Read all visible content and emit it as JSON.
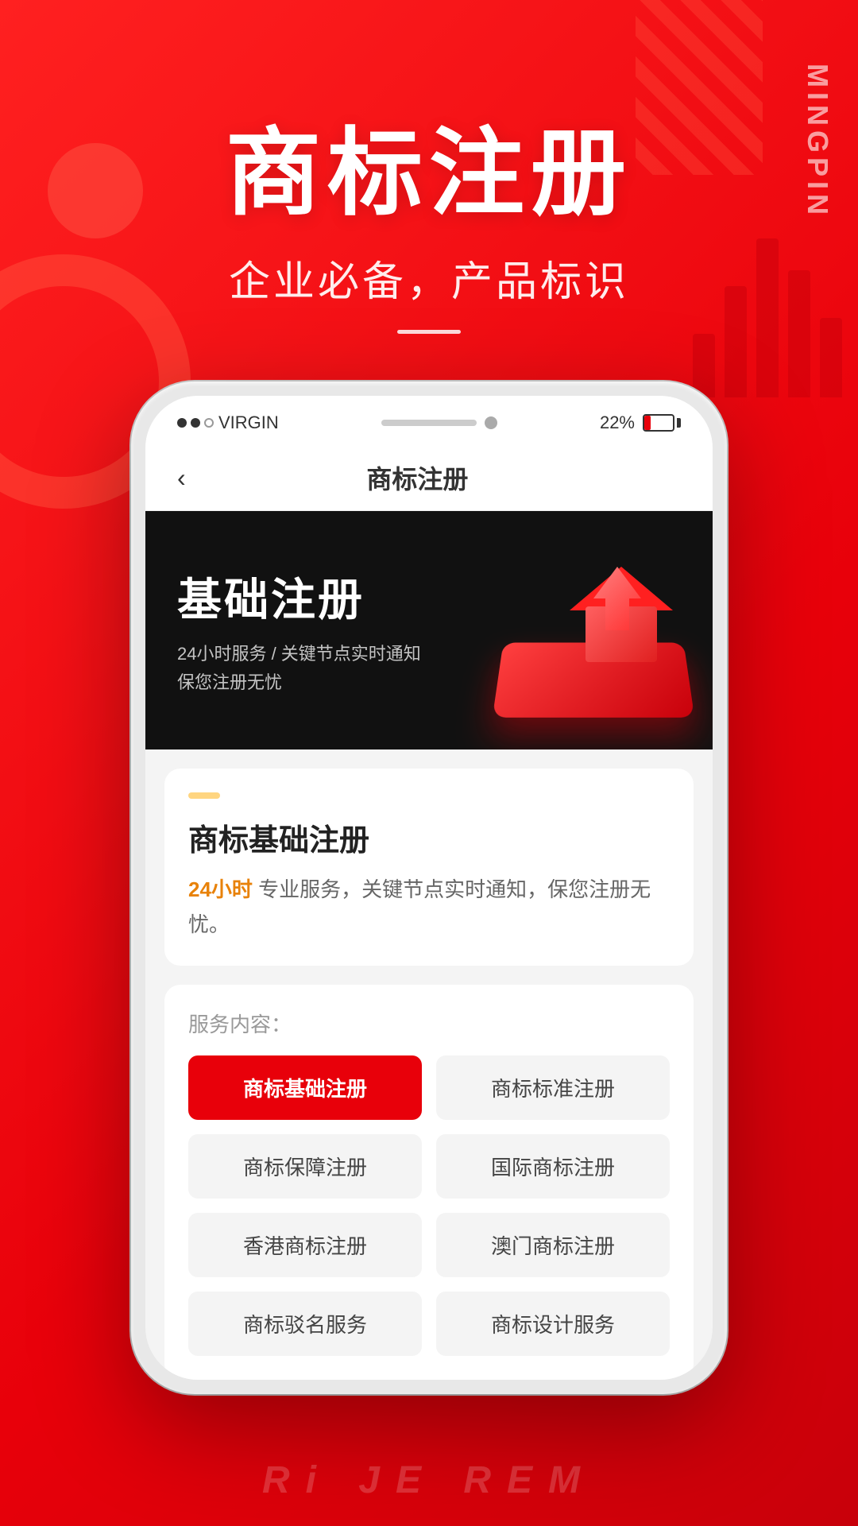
{
  "app": {
    "side_text": "MINGPIN"
  },
  "hero": {
    "title": "商标注册",
    "subtitle": "企业必备，产品标识",
    "divider": "——"
  },
  "phone": {
    "status": {
      "carrier": "VIRGIN",
      "battery_percent": "22%"
    },
    "nav": {
      "back_symbol": "‹",
      "title": "商标注册"
    },
    "banner": {
      "title": "基础注册",
      "desc_line1": "24小时服务 / 关键节点实时通知",
      "desc_line2": "保您注册无忧"
    },
    "card": {
      "tag": "",
      "title": "商标基础注册",
      "desc_prefix": "",
      "highlight": "24小时",
      "desc": "专业服务，关键节点实时通知，保您注册无忧。"
    },
    "service": {
      "label": "服务内容：",
      "buttons": [
        {
          "label": "商标基础注册",
          "active": true
        },
        {
          "label": "商标标准注册",
          "active": false
        },
        {
          "label": "商标保障注册",
          "active": false
        },
        {
          "label": "国际商标注册",
          "active": false
        },
        {
          "label": "香港商标注册",
          "active": false
        },
        {
          "label": "澳门商标注册",
          "active": false
        },
        {
          "label": "商标驳名服务",
          "active": false
        },
        {
          "label": "商标设计服务",
          "active": false
        }
      ]
    }
  },
  "bottom": {
    "text": "Ri JE REM"
  }
}
